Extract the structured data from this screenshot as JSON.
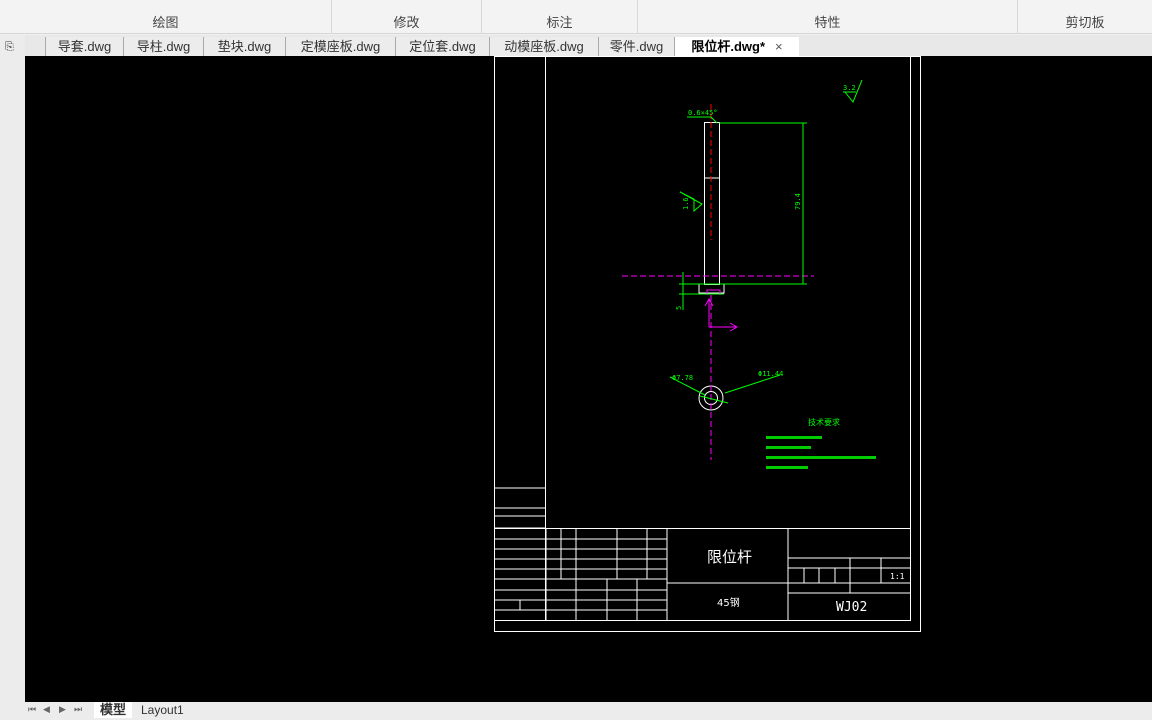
{
  "ribbon": {
    "groups": [
      "绘图",
      "修改",
      "标注",
      "特性",
      "剪切板"
    ]
  },
  "tabs": [
    {
      "label": "导套.dwg"
    },
    {
      "label": "导柱.dwg"
    },
    {
      "label": "垫块.dwg"
    },
    {
      "label": "定模座板.dwg"
    },
    {
      "label": "定位套.dwg"
    },
    {
      "label": "动模座板.dwg"
    },
    {
      "label": "零件.dwg"
    },
    {
      "label": "限位杆.dwg*",
      "active": true
    }
  ],
  "close_symbol": "×",
  "drawing": {
    "chamfer": "0.6×45°",
    "roughness_top": "3.2",
    "roughness_side": "1.6",
    "length": "79.4",
    "thickness": "5",
    "dia_left": "Φ7.78",
    "dia_right": "Φ11.44",
    "tech_title": "技术要求",
    "part_name": "限位杆",
    "material": "45钢",
    "drawing_no": "WJ02",
    "scale": "1:1"
  },
  "layout_tabs": [
    "模型",
    "Layout1"
  ],
  "colors": {
    "canvas": "#000000",
    "green": "#00ff00",
    "magenta": "#ff00ff",
    "white": "#ffffff",
    "center": "#ff0000"
  }
}
